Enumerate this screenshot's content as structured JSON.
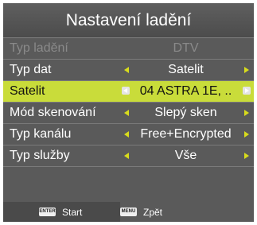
{
  "title": "Nastavení ladění",
  "rows": [
    {
      "label": "Typ ladění",
      "value": "DTV"
    },
    {
      "label": "Typ dat",
      "value": "Satelit"
    },
    {
      "label": "Satelit",
      "value": "04 ASTRA 1E, .."
    },
    {
      "label": "Mód skenování",
      "value": "Slepý sken"
    },
    {
      "label": "Typ kanálu",
      "value": "Free+Encrypted"
    },
    {
      "label": "Typ služby",
      "value": "Vše"
    }
  ],
  "footer": {
    "enter_key": "ENTER",
    "enter_label": "Start",
    "menu_key": "MENU",
    "menu_label": "Zpět"
  },
  "colors": {
    "panel": "#5a5a5a",
    "highlight": "#c9dc3a",
    "arrow": "#d8dc1c",
    "disabled_text": "#8a8a8a"
  },
  "icons": {
    "left": "triangle-left-icon",
    "right": "triangle-right-icon"
  }
}
